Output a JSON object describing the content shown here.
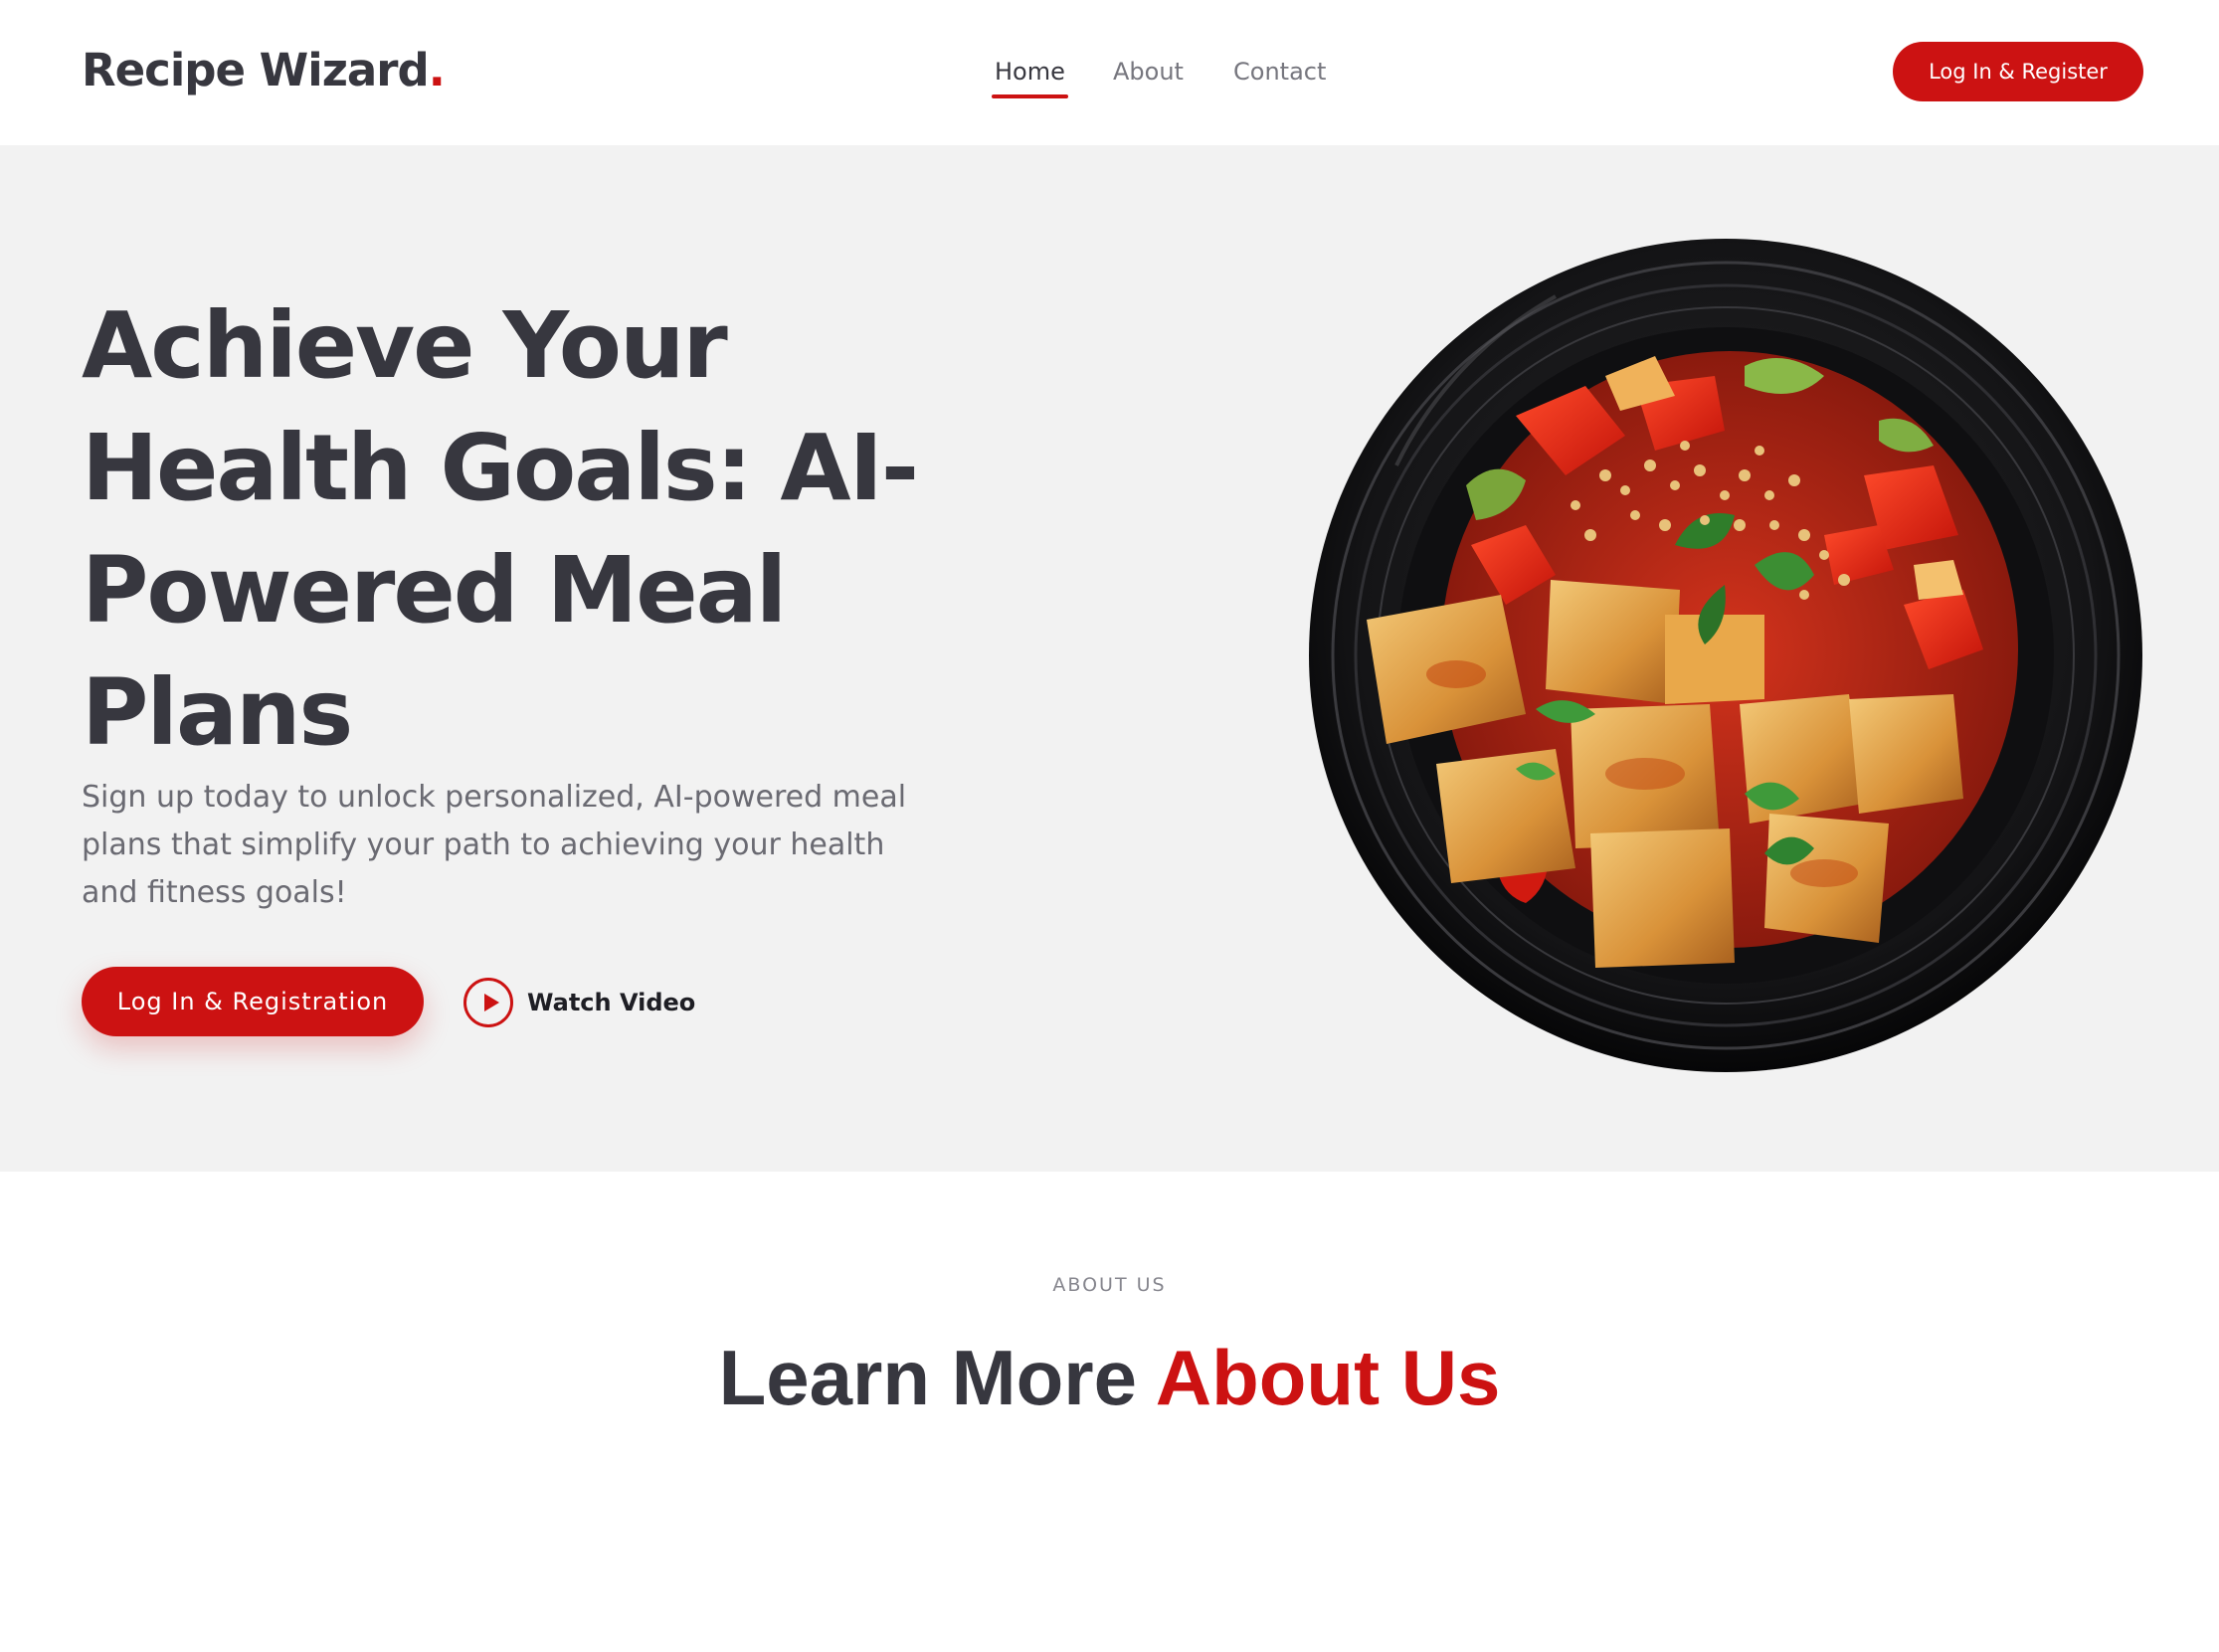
{
  "header": {
    "logo_text": "Recipe Wizard",
    "logo_dot": ".",
    "nav": {
      "home": "Home",
      "about": "About",
      "contact": "Contact"
    },
    "active_nav": "Home",
    "cta_label": "Log In & Register"
  },
  "hero": {
    "title": "Achieve Your Health Goals: AI-Powered Meal Plans",
    "subtitle": "Sign up today to unlock personalized, AI-powered meal plans that simplify your path to achieving your health and fitness goals!",
    "primary_button": "Log In & Registration",
    "video_link": "Watch Video",
    "video_icon": "play-circle-icon",
    "image": "tofu-stir-fry-bowl"
  },
  "about": {
    "eyebrow": "ABOUT US",
    "title_plain": "Learn More ",
    "title_accent": "About Us"
  },
  "colors": {
    "accent": "#cc1212",
    "text_dark": "#37373f",
    "hero_bg": "#f2f2f2"
  }
}
